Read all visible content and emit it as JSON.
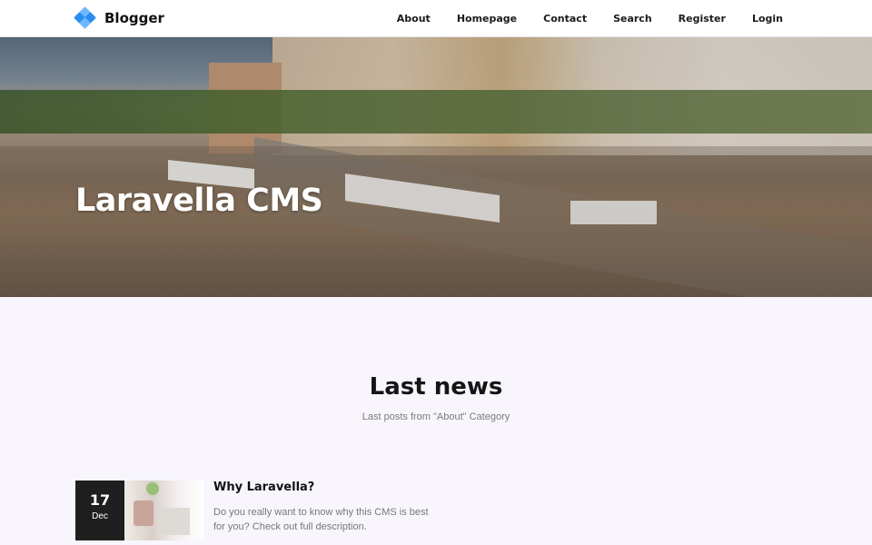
{
  "brand": {
    "name": "Blogger",
    "logo_icon": "blue-diamond-cluster-icon"
  },
  "nav": {
    "items": [
      "About",
      "Homepage",
      "Contact",
      "Search",
      "Register",
      "Login"
    ]
  },
  "hero": {
    "title": "Laravella CMS",
    "image": "city-riverside-photo"
  },
  "section": {
    "title": "Last news",
    "subtitle": "Last posts from \"About\" Category"
  },
  "posts": [
    {
      "day": "17",
      "month": "Dec",
      "title": "Why Laravella?",
      "excerpt": "Do you really want to know why this CMS is best for you? Check out full description."
    }
  ],
  "colors": {
    "accent": "#2d8cf0",
    "date_badge": "#1f1f1f",
    "page_bg": "#f8f6fc"
  }
}
